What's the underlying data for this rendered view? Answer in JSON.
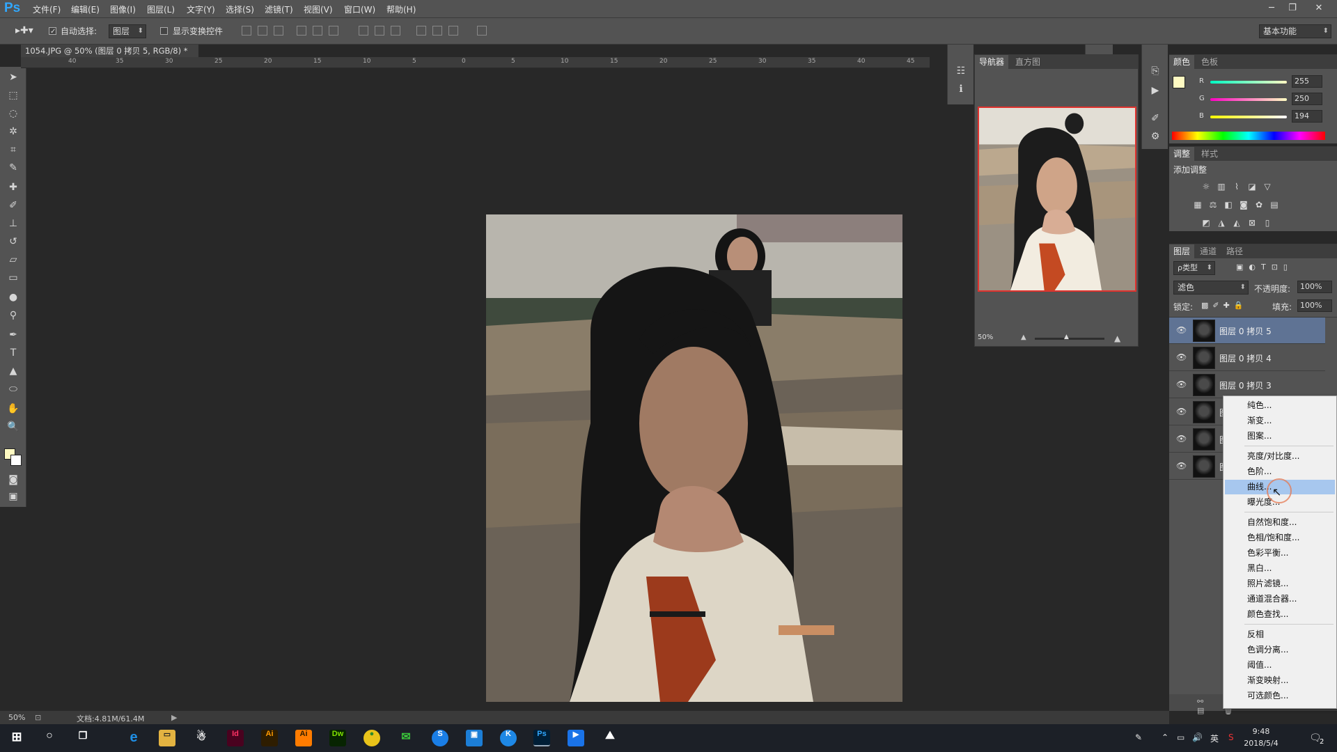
{
  "app": {
    "logo": "Ps",
    "menu": [
      "文件(F)",
      "编辑(E)",
      "图像(I)",
      "图层(L)",
      "文字(Y)",
      "选择(S)",
      "滤镜(T)",
      "视图(V)",
      "窗口(W)",
      "帮助(H)"
    ],
    "window_controls": [
      "─",
      "❐",
      "✕"
    ]
  },
  "options": {
    "auto_select_label": "自动选择:",
    "auto_select_value": "图层",
    "show_transform_label": "显示变换控件",
    "workspace": "基本功能"
  },
  "document": {
    "tab_title": "1054.JPG @ 50% (图层 0 拷贝 5, RGB/8) *",
    "ruler_ticks": [
      "40",
      "35",
      "30",
      "25",
      "20",
      "15",
      "10",
      "5",
      "0",
      "5",
      "10",
      "15",
      "20",
      "25",
      "30",
      "35",
      "40",
      "45"
    ]
  },
  "navigator": {
    "tabs": [
      "导航器",
      "直方图"
    ],
    "zoom": "50%"
  },
  "color_panel": {
    "tabs": [
      "颜色",
      "色板"
    ],
    "r_label": "R",
    "r_value": "255",
    "g_label": "G",
    "g_value": "250",
    "b_label": "B",
    "b_value": "194",
    "foreground": "#fffac2"
  },
  "adjustments_panel": {
    "tabs": [
      "调整",
      "样式"
    ],
    "title": "添加调整"
  },
  "layers_panel": {
    "tabs": [
      "图层",
      "通道",
      "路径"
    ],
    "filter_kind": "ρ类型",
    "blend_mode": "滤色",
    "opacity_label": "不透明度:",
    "opacity_value": "100%",
    "lock_label": "锁定:",
    "fill_label": "填充:",
    "fill_value": "100%",
    "layers": [
      {
        "name": "图层 0 拷贝 5",
        "selected": true
      },
      {
        "name": "图层 0 拷贝 4",
        "selected": false
      },
      {
        "name": "图层 0 拷贝 3",
        "selected": false
      },
      {
        "name": "图",
        "selected": false
      },
      {
        "name": "图",
        "selected": false
      },
      {
        "name": "图",
        "selected": false
      }
    ]
  },
  "context_menu": {
    "group1": [
      "纯色...",
      "渐变...",
      "图案..."
    ],
    "group2": [
      "亮度/对比度...",
      "色阶...",
      "曲线...",
      "曝光度..."
    ],
    "group3": [
      "自然饱和度...",
      "色相/饱和度...",
      "色彩平衡...",
      "黑白...",
      "照片滤镜...",
      "通道混合器...",
      "颜色查找..."
    ],
    "group4": [
      "反相",
      "色调分离...",
      "阈值...",
      "渐变映射...",
      "可选颜色..."
    ],
    "highlighted": "曲线..."
  },
  "status": {
    "zoom": "50%",
    "doc_info": "文档:4.81M/61.4M"
  },
  "taskbar": {
    "apps": [
      "Id",
      "Ai",
      "Ai",
      "Dw",
      "Ps"
    ],
    "ime": "英",
    "time": "9:48",
    "date": "2018/5/4",
    "notif_count": "2"
  },
  "colors": {
    "ui_bg": "#535353",
    "canvas_bg": "#282828",
    "selection": "#5f7394",
    "menu_highlight": "#a7c7ee",
    "ps_blue": "#31a8ff"
  }
}
